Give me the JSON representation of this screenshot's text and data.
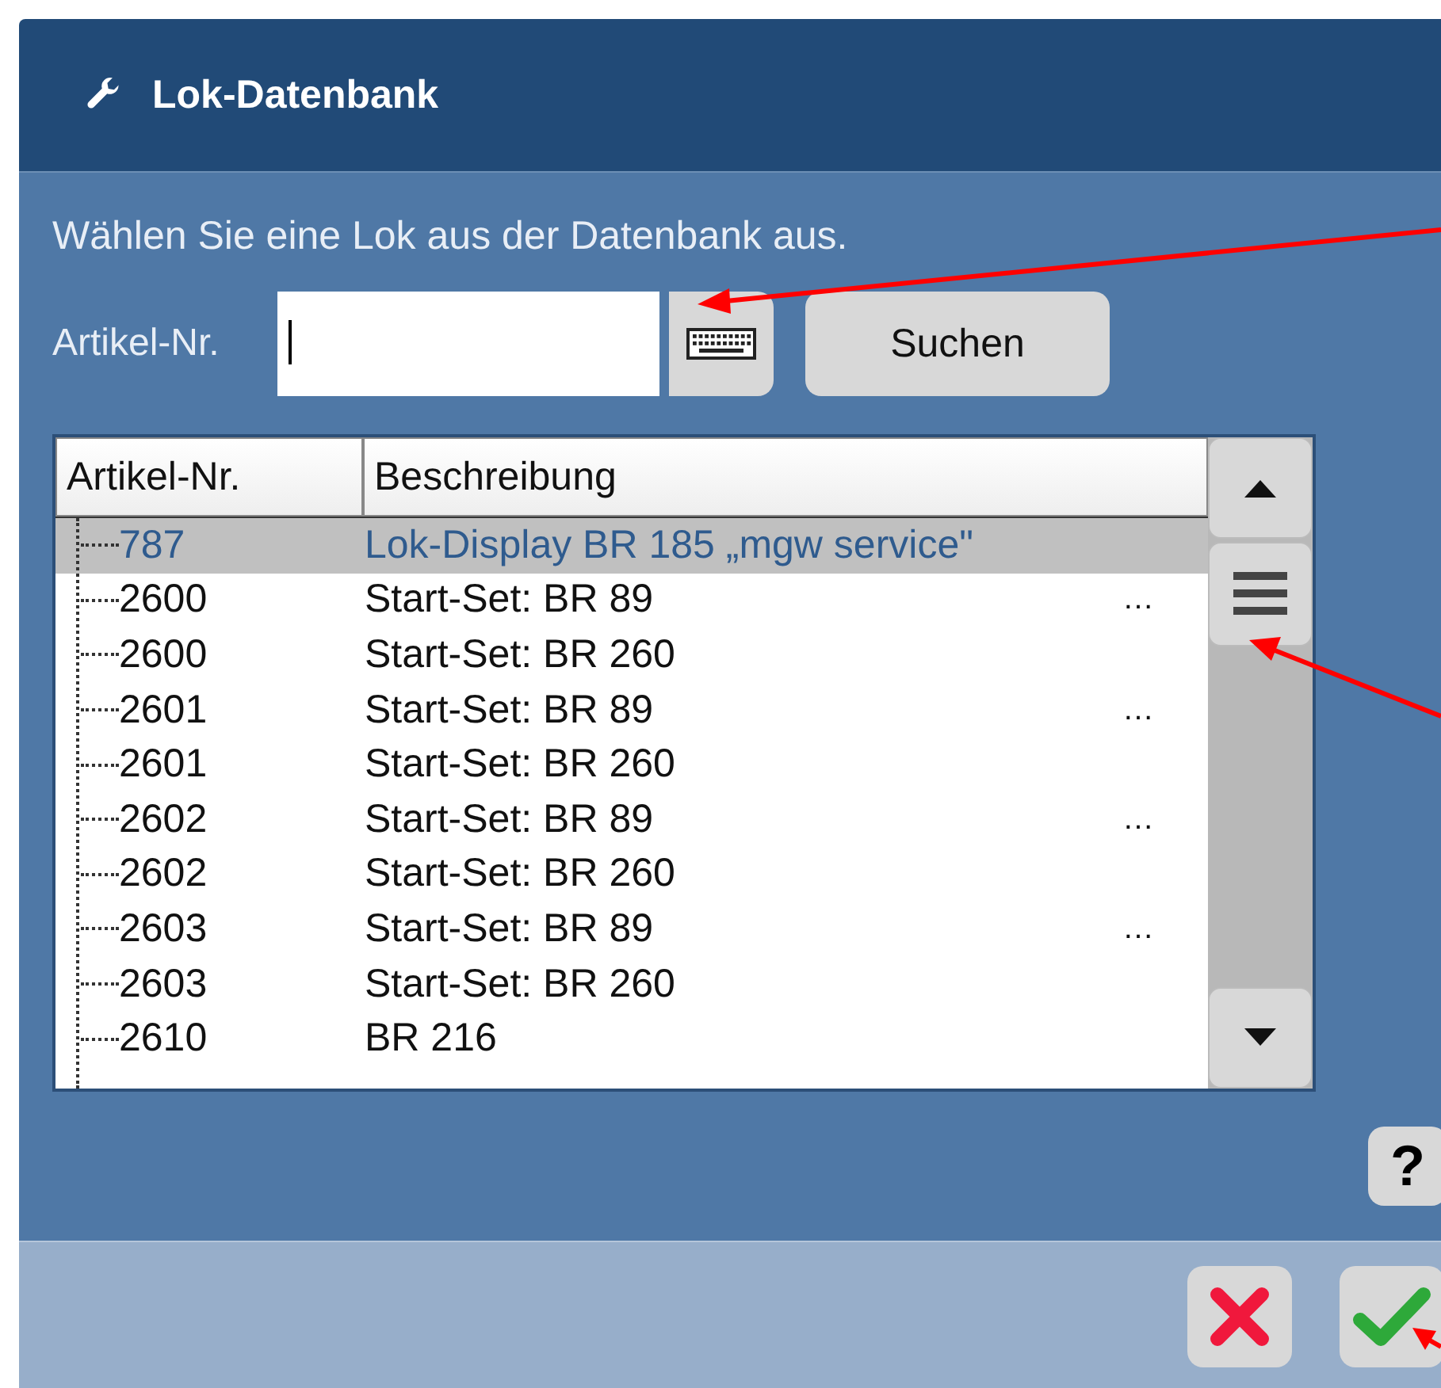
{
  "dialog": {
    "title": "Lok-Datenbank"
  },
  "instruction": "Wählen Sie eine Lok aus der Datenbank aus.",
  "search": {
    "label": "Artikel-Nr.",
    "button": "Suchen"
  },
  "table": {
    "columns": [
      "Artikel-Nr.",
      "Beschreibung"
    ],
    "rows": [
      {
        "number": "787",
        "description": "Lok-Display BR 185 „mgw service\"",
        "selected": true
      },
      {
        "number": "2600",
        "description": "Start-Set: BR 89",
        "ellipsis": "…",
        "selected": false
      },
      {
        "number": "2600",
        "description": "Start-Set: BR 260",
        "selected": false
      },
      {
        "number": "2601",
        "description": "Start-Set: BR 89",
        "ellipsis": "…",
        "selected": false
      },
      {
        "number": "2601",
        "description": "Start-Set: BR 260",
        "selected": false
      },
      {
        "number": "2602",
        "description": "Start-Set: BR 89",
        "ellipsis": "…",
        "selected": false
      },
      {
        "number": "2602",
        "description": "Start-Set: BR 260",
        "selected": false
      },
      {
        "number": "2603",
        "description": "Start-Set: BR 89",
        "ellipsis": "…",
        "selected": false
      },
      {
        "number": "2603",
        "description": "Start-Set: BR 260",
        "selected": false
      },
      {
        "number": "2610",
        "description": "BR 216",
        "selected": false
      }
    ]
  },
  "help_button": "?"
}
